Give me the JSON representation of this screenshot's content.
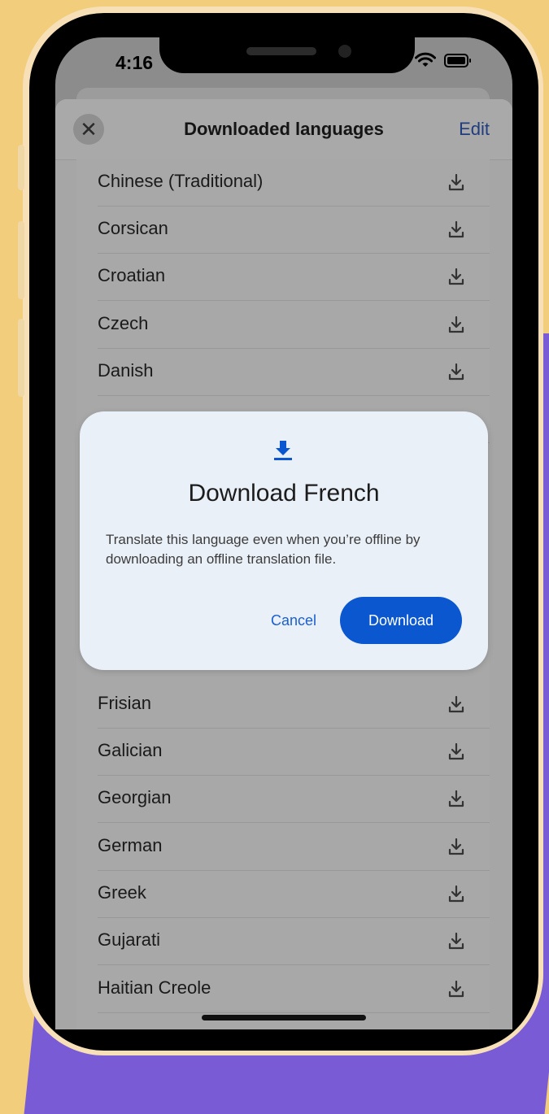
{
  "status_bar": {
    "time": "4:16"
  },
  "sheet": {
    "title": "Downloaded languages",
    "edit_label": "Edit",
    "close_icon": "close-icon"
  },
  "languages": [
    {
      "label": "Chinese (Traditional)",
      "icon": "download-icon"
    },
    {
      "label": "Corsican",
      "icon": "download-icon"
    },
    {
      "label": "Croatian",
      "icon": "download-icon"
    },
    {
      "label": "Czech",
      "icon": "download-icon"
    },
    {
      "label": "Danish",
      "icon": "download-icon"
    },
    {
      "label": "Frisian",
      "icon": "download-icon"
    },
    {
      "label": "Galician",
      "icon": "download-icon"
    },
    {
      "label": "Georgian",
      "icon": "download-icon"
    },
    {
      "label": "German",
      "icon": "download-icon"
    },
    {
      "label": "Greek",
      "icon": "download-icon"
    },
    {
      "label": "Gujarati",
      "icon": "download-icon"
    },
    {
      "label": "Haitian Creole",
      "icon": "download-icon"
    }
  ],
  "dialog": {
    "icon": "download-icon",
    "title": "Download French",
    "body": "Translate this language even when you’re offline by downloading an offline translation file.",
    "cancel_label": "Cancel",
    "download_label": "Download"
  },
  "colors": {
    "accent": "#0b57d0",
    "background": "#f2cd7c",
    "decor_purple": "#7a5bd6"
  }
}
